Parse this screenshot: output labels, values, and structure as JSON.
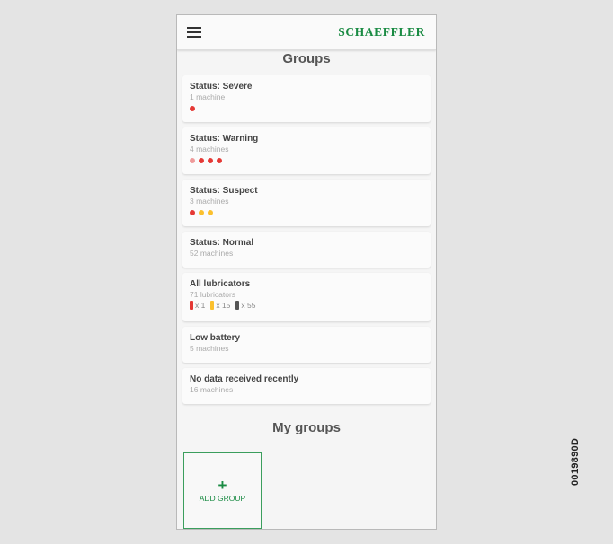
{
  "app": {
    "brand": "SCHAEFFLER"
  },
  "groups_title": "Groups",
  "cards": [
    {
      "title": "Status: Severe",
      "subtitle": "1 machine",
      "dots": [
        "#e53935"
      ]
    },
    {
      "title": "Status: Warning",
      "subtitle": "4 machines",
      "dots": [
        "#ef9a9a",
        "#e53935",
        "#e53935",
        "#e53935"
      ]
    },
    {
      "title": "Status: Suspect",
      "subtitle": "3 machines",
      "dots": [
        "#e53935",
        "#fbc02d",
        "#fbc02d"
      ]
    },
    {
      "title": "Status: Normal",
      "subtitle": "52 machines"
    }
  ],
  "lubricators": {
    "title": "All lubricators",
    "subtitle": "71 lubricators",
    "items": [
      {
        "color": "#e53935",
        "count": "x 1"
      },
      {
        "color": "#fbc02d",
        "count": "x 15"
      },
      {
        "color": "#555555",
        "count": "x 55"
      }
    ]
  },
  "battery": {
    "title": "Low battery",
    "subtitle": "5 machines"
  },
  "nodata": {
    "title": "No data received recently",
    "subtitle": "16 machines"
  },
  "my_groups_title": "My groups",
  "add_group": {
    "icon": "+",
    "label": "ADD GROUP"
  },
  "figure_code": "0019890D"
}
